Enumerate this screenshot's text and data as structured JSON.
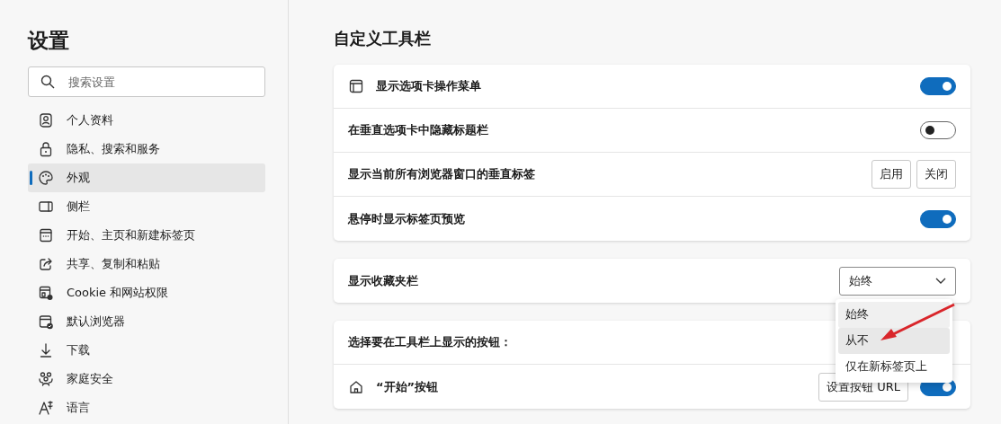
{
  "sidebar": {
    "title": "设置",
    "search": {
      "placeholder": "搜索设置"
    },
    "items": [
      {
        "label": "个人资料",
        "selected": false
      },
      {
        "label": "隐私、搜索和服务",
        "selected": false
      },
      {
        "label": "外观",
        "selected": true
      },
      {
        "label": "侧栏",
        "selected": false
      },
      {
        "label": "开始、主页和新建标签页",
        "selected": false
      },
      {
        "label": "共享、复制和粘贴",
        "selected": false
      },
      {
        "label": "Cookie 和网站权限",
        "selected": false
      },
      {
        "label": "默认浏览器",
        "selected": false
      },
      {
        "label": "下载",
        "selected": false
      },
      {
        "label": "家庭安全",
        "selected": false
      },
      {
        "label": "语言",
        "selected": false
      }
    ]
  },
  "main": {
    "title": "自定义工具栏",
    "cards": [
      {
        "rows": [
          {
            "kind": "toggle",
            "label": "显示选项卡操作菜单",
            "on": true
          },
          {
            "kind": "toggle",
            "label": "在垂直选项卡中隐藏标题栏",
            "on": false
          },
          {
            "kind": "buttons",
            "label": "显示当前所有浏览器窗口的垂直标签",
            "buttons": [
              "启用",
              "关闭"
            ]
          },
          {
            "kind": "toggle",
            "label": "悬停时显示标签页预览",
            "on": true
          }
        ]
      },
      {
        "rows": [
          {
            "kind": "select",
            "label": "显示收藏夹栏",
            "value": "始终",
            "expanded": true,
            "options": [
              {
                "label": "始终",
                "selected": true,
                "hovered": false
              },
              {
                "label": "从不",
                "selected": false,
                "hovered": true
              },
              {
                "label": "仅在新标签页上",
                "selected": false,
                "hovered": false
              }
            ]
          }
        ]
      },
      {
        "rows": [
          {
            "kind": "heading",
            "label": "选择要在工具栏上显示的按钮："
          },
          {
            "kind": "button-toggle",
            "label": "“开始”按钮",
            "button": "设置按钮 URL",
            "on": true
          }
        ]
      }
    ]
  }
}
